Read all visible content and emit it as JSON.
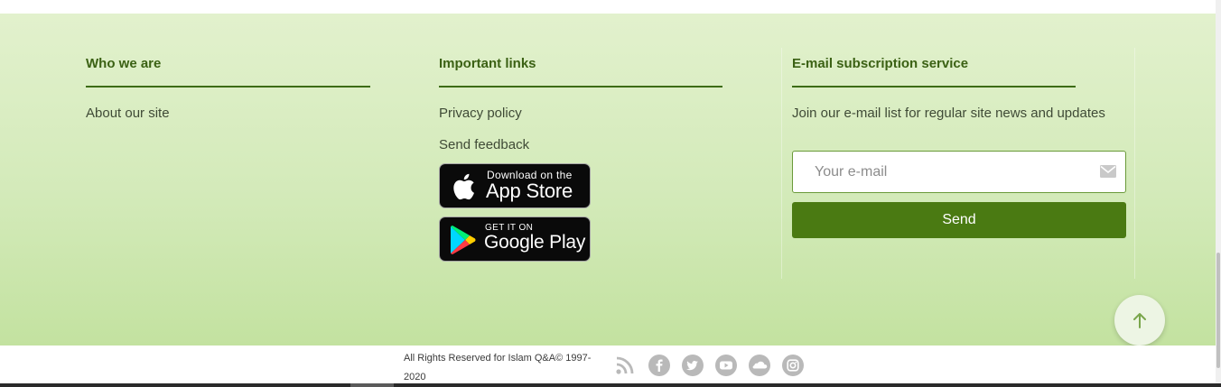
{
  "footer": {
    "who_we_are": {
      "title": "Who we are",
      "links": [
        "About our site"
      ]
    },
    "important_links": {
      "title": "Important links",
      "links": [
        "Privacy policy",
        "Send feedback"
      ],
      "app_store": {
        "small": "Download on the",
        "big": "App Store"
      },
      "google_play": {
        "small": "GET IT ON",
        "big": "Google Play"
      }
    },
    "subscription": {
      "title": "E-mail subscription service",
      "description": "Join our e-mail list for regular site news and updates",
      "email_placeholder": "Your e-mail",
      "send_label": "Send"
    }
  },
  "bottom_bar": {
    "copyright": "All Rights Reserved for Islam Q&A© 1997-2020",
    "social_icons": [
      "rss-icon",
      "facebook-icon",
      "twitter-icon",
      "youtube-icon",
      "soundcloud-icon",
      "instagram-icon"
    ]
  },
  "colors": {
    "accent": "#4a7a12",
    "heading": "#3b6114",
    "footer_background": "#d3eab9"
  }
}
